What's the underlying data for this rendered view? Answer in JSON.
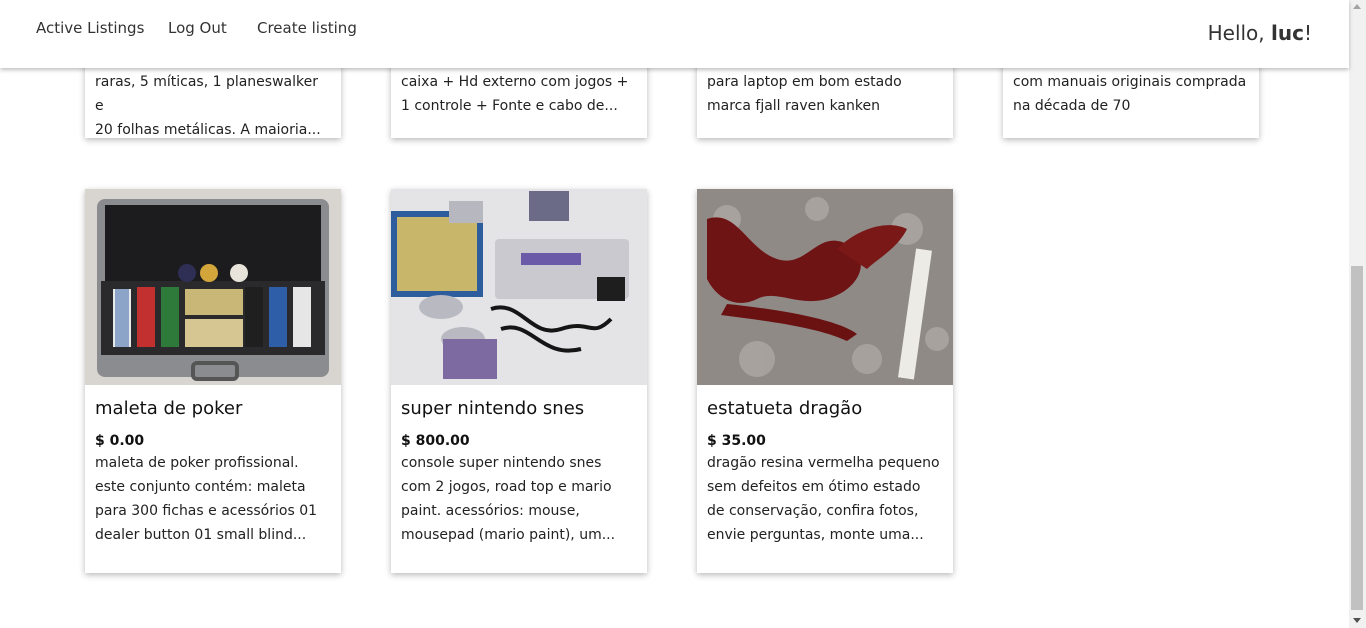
{
  "nav": {
    "links": [
      "Active Listings",
      "Log Out",
      "Create listing"
    ],
    "greeting_prefix": "Hello, ",
    "user": "luc",
    "greeting_suffix": "!"
  },
  "top_cards": [
    {
      "line1": "raras, 5 míticas, 1 planeswalker e",
      "line2": "20 folhas metálicas. A maioria..."
    },
    {
      "line1": "caixa + Hd externo com jogos +",
      "line2": "1 controle + Fonte e cabo de..."
    },
    {
      "line1": "para laptop em bom estado",
      "line2": "marca fjall raven kanken"
    },
    {
      "line1": "com manuais originais comprada",
      "line2": "na década de 70"
    }
  ],
  "cards": [
    {
      "title": "maleta de poker",
      "price": "$ 0.00",
      "desc": [
        "maleta de poker profissional.",
        "este conjunto contém: maleta",
        "para 300 fichas e acessórios 01",
        "dealer button 01 small blind..."
      ]
    },
    {
      "title": "super nintendo snes",
      "price": "$ 800.00",
      "desc": [
        "console super nintendo snes",
        "com 2 jogos, road top e mario",
        "paint. acessórios: mouse,",
        "mousepad (mario paint), um..."
      ]
    },
    {
      "title": "estatueta dragão",
      "price": "$ 35.00",
      "desc": [
        "dragão resina vermelha pequeno",
        "sem defeitos em ótimo estado",
        "de conservação, confira fotos,",
        "envie perguntas, monte uma..."
      ]
    }
  ]
}
